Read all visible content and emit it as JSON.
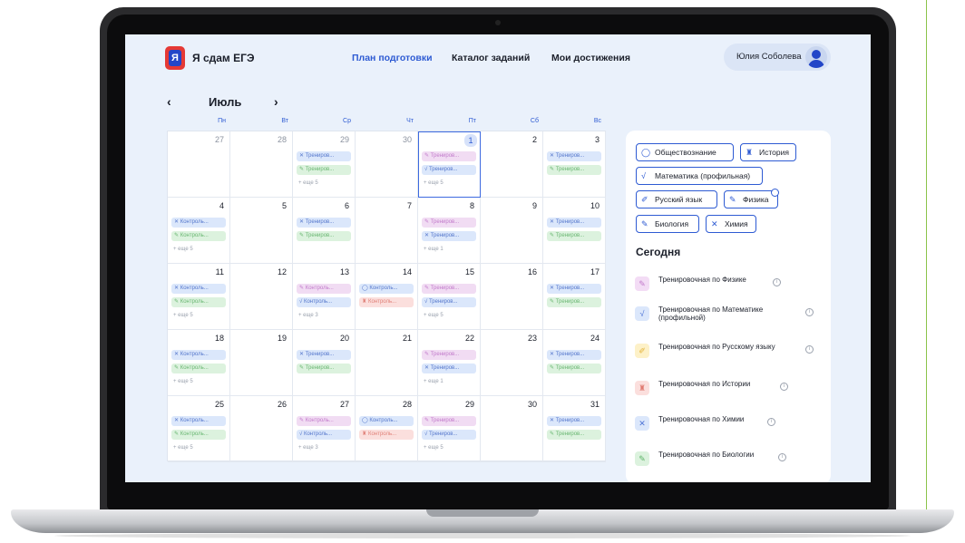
{
  "header": {
    "brand": "Я сдам ЕГЭ",
    "logo_letter": "Я",
    "nav": [
      "План подготовки",
      "Каталог заданий",
      "Мои достижения"
    ],
    "user_name": "Юлия Соболева"
  },
  "calendar": {
    "month": "Июль",
    "prev": "‹",
    "next": "›",
    "weekdays": [
      "Пн",
      "Вт",
      "Ср",
      "Чт",
      "Пт",
      "Сб",
      "Вс"
    ],
    "weeks": [
      [
        {
          "day": "27",
          "muted": true,
          "events": [],
          "more": ""
        },
        {
          "day": "28",
          "muted": true,
          "events": [],
          "more": ""
        },
        {
          "day": "29",
          "muted": true,
          "events": [
            {
              "c": "blue",
              "t": "✕ Трениров..."
            },
            {
              "c": "green",
              "t": "✎ Трениров..."
            }
          ],
          "more": "+ еще 5"
        },
        {
          "day": "30",
          "muted": true,
          "events": [],
          "more": ""
        },
        {
          "day": "1",
          "selected": true,
          "events": [
            {
              "c": "pink",
              "t": "✎ Трениров..."
            },
            {
              "c": "blue",
              "t": "√ Трениров..."
            }
          ],
          "more": "+ еще 5"
        },
        {
          "day": "2",
          "events": [],
          "more": ""
        },
        {
          "day": "3",
          "events": [
            {
              "c": "blue",
              "t": "✕ Трениров..."
            },
            {
              "c": "green",
              "t": "✎ Трениров..."
            }
          ],
          "more": ""
        }
      ],
      [
        {
          "day": "4",
          "events": [
            {
              "c": "blue",
              "t": "✕ Контроль..."
            },
            {
              "c": "green",
              "t": "✎ Контроль..."
            }
          ],
          "more": "+ еще 5"
        },
        {
          "day": "5",
          "events": [],
          "more": ""
        },
        {
          "day": "6",
          "events": [
            {
              "c": "blue",
              "t": "✕ Трениров..."
            },
            {
              "c": "green",
              "t": "✎ Трениров..."
            }
          ],
          "more": ""
        },
        {
          "day": "7",
          "events": [],
          "more": ""
        },
        {
          "day": "8",
          "events": [
            {
              "c": "pink",
              "t": "✎ Трениров..."
            },
            {
              "c": "blue",
              "t": "✕ Трениров..."
            }
          ],
          "more": "+ еще 1"
        },
        {
          "day": "9",
          "events": [],
          "more": ""
        },
        {
          "day": "10",
          "events": [
            {
              "c": "blue",
              "t": "✕ Трениров..."
            },
            {
              "c": "green",
              "t": "✎ Трениров..."
            }
          ],
          "more": ""
        }
      ],
      [
        {
          "day": "11",
          "events": [
            {
              "c": "blue",
              "t": "✕ Контроль..."
            },
            {
              "c": "green",
              "t": "✎ Контроль..."
            }
          ],
          "more": "+ еще 5"
        },
        {
          "day": "12",
          "events": [],
          "more": ""
        },
        {
          "day": "13",
          "events": [
            {
              "c": "pink",
              "t": "✎ Контроль..."
            },
            {
              "c": "blue",
              "t": "√ Контроль..."
            }
          ],
          "more": "+ еще 3"
        },
        {
          "day": "14",
          "events": [
            {
              "c": "blue",
              "t": "◯ Контроль..."
            },
            {
              "c": "red",
              "t": "♜ Контроль..."
            }
          ],
          "more": ""
        },
        {
          "day": "15",
          "events": [
            {
              "c": "pink",
              "t": "✎ Трениров..."
            },
            {
              "c": "blue",
              "t": "√ Трениров..."
            }
          ],
          "more": "+ еще 5"
        },
        {
          "day": "16",
          "events": [],
          "more": ""
        },
        {
          "day": "17",
          "events": [
            {
              "c": "blue",
              "t": "✕ Трениров..."
            },
            {
              "c": "green",
              "t": "✎ Трениров..."
            }
          ],
          "more": ""
        }
      ],
      [
        {
          "day": "18",
          "events": [
            {
              "c": "blue",
              "t": "✕ Контроль..."
            },
            {
              "c": "green",
              "t": "✎ Контроль..."
            }
          ],
          "more": "+ еще 5"
        },
        {
          "day": "19",
          "events": [],
          "more": ""
        },
        {
          "day": "20",
          "events": [
            {
              "c": "blue",
              "t": "✕ Трениров..."
            },
            {
              "c": "green",
              "t": "✎ Трениров..."
            }
          ],
          "more": ""
        },
        {
          "day": "21",
          "events": [],
          "more": ""
        },
        {
          "day": "22",
          "events": [
            {
              "c": "pink",
              "t": "✎ Трениров..."
            },
            {
              "c": "blue",
              "t": "✕ Трениров..."
            }
          ],
          "more": "+ еще 1"
        },
        {
          "day": "23",
          "events": [],
          "more": ""
        },
        {
          "day": "24",
          "events": [
            {
              "c": "blue",
              "t": "✕ Трениров..."
            },
            {
              "c": "green",
              "t": "✎ Трениров..."
            }
          ],
          "more": ""
        }
      ],
      [
        {
          "day": "25",
          "events": [
            {
              "c": "blue",
              "t": "✕ Контроль..."
            },
            {
              "c": "green",
              "t": "✎ Контроль..."
            }
          ],
          "more": "+ еще 5"
        },
        {
          "day": "26",
          "events": [],
          "more": ""
        },
        {
          "day": "27",
          "events": [
            {
              "c": "pink",
              "t": "✎ Контроль..."
            },
            {
              "c": "blue",
              "t": "√ Контроль..."
            }
          ],
          "more": "+ еще 3"
        },
        {
          "day": "28",
          "events": [
            {
              "c": "blue",
              "t": "◯ Контроль..."
            },
            {
              "c": "red",
              "t": "♜ Контроль..."
            }
          ],
          "more": ""
        },
        {
          "day": "29",
          "events": [
            {
              "c": "pink",
              "t": "✎ Трениров..."
            },
            {
              "c": "blue",
              "t": "√ Трениров..."
            }
          ],
          "more": "+ еще 5"
        },
        {
          "day": "30",
          "events": [],
          "more": ""
        },
        {
          "day": "31",
          "events": [
            {
              "c": "blue",
              "t": "✕ Трениров..."
            },
            {
              "c": "green",
              "t": "✎ Трениров..."
            }
          ],
          "more": ""
        }
      ]
    ]
  },
  "filters": [
    {
      "icon": "◯",
      "label": "Обществознание",
      "name": "social-studies"
    },
    {
      "icon": "♜",
      "label": "История",
      "name": "history"
    },
    {
      "icon": "√",
      "label": "Математика (профильная)",
      "name": "math"
    },
    {
      "icon": "✐",
      "label": "Русский язык",
      "name": "russian"
    },
    {
      "icon": "✎",
      "label": "Физика",
      "name": "physics"
    },
    {
      "icon": "✎",
      "label": "Биология",
      "name": "biology"
    },
    {
      "icon": "✕",
      "label": "Химия",
      "name": "chemistry"
    }
  ],
  "today": {
    "title": "Сегодня",
    "items": [
      {
        "icon": "✎",
        "color": "pink",
        "label": "Тренировочная по Физике"
      },
      {
        "icon": "√",
        "color": "blue",
        "label": "Тренировочная по Математике (профильной)"
      },
      {
        "icon": "✐",
        "color": "yellow",
        "label": "Тренировочная по Русскому языку"
      },
      {
        "icon": "♜",
        "color": "red",
        "label": "Тренировочная по Истории"
      },
      {
        "icon": "✕",
        "color": "blue",
        "label": "Тренировочная по Химии"
      },
      {
        "icon": "✎",
        "color": "green",
        "label": "Тренировочная по Биологии"
      }
    ],
    "info_glyph": "i"
  },
  "colors": {
    "accent": "#2e5bd3",
    "screen_bg": "#eaf1fb",
    "side_line": "#8bc34a"
  }
}
